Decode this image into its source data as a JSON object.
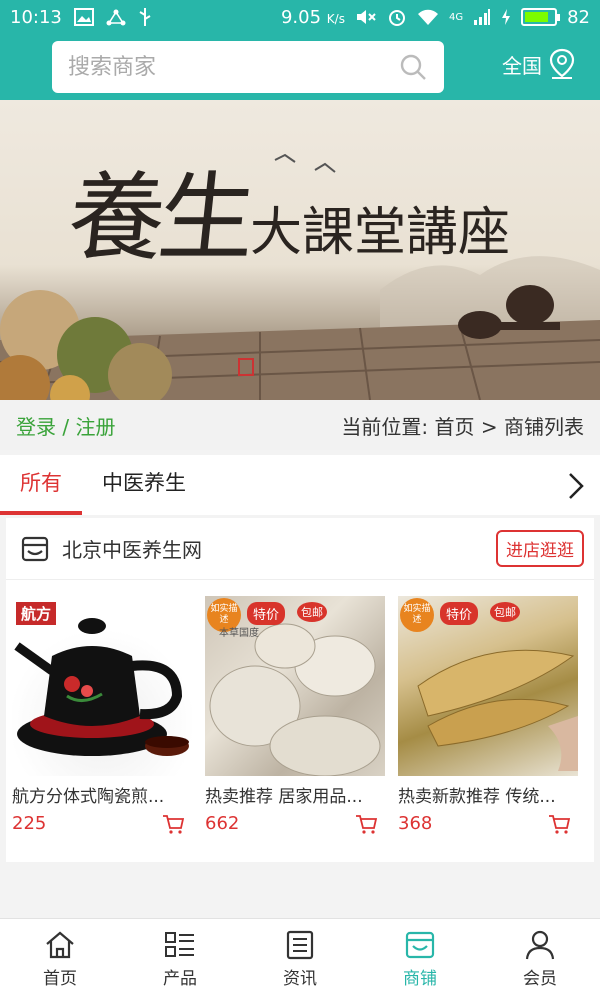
{
  "status_bar": {
    "time": "10:13",
    "speed": "9.05",
    "speed_unit": "K/s",
    "network": "4G",
    "battery": "82",
    "battery_level": 0.82
  },
  "search": {
    "placeholder": "搜索商家",
    "region_label": "全国"
  },
  "banner": {
    "title_big": "養生",
    "title_small": "大課堂講座"
  },
  "account": {
    "login_label": "登录 / 注册",
    "breadcrumb": "当前位置: 首页 > 商铺列表"
  },
  "tabs": [
    {
      "label": "所有",
      "active": true
    },
    {
      "label": "中医养生",
      "active": false
    }
  ],
  "shop": {
    "name": "北京中医养生网",
    "visit_label": "进店逛逛"
  },
  "products": [
    {
      "title": "航方分体式陶瓷煎...",
      "price": "225",
      "brand": "航方"
    },
    {
      "title": "热卖推荐 居家用品...",
      "price": "662",
      "badge_round": "如实描述",
      "badge_tag": "特价",
      "badge_mail": "包邮",
      "watermark": "本草国度"
    },
    {
      "title": "热卖新款推荐 传统...",
      "price": "368",
      "badge_round": "如实描述",
      "badge_tag": "特价",
      "badge_mail": "包邮"
    }
  ],
  "bottom_nav": [
    {
      "label": "首页",
      "icon": "home-icon"
    },
    {
      "label": "产品",
      "icon": "grid-list-icon"
    },
    {
      "label": "资讯",
      "icon": "news-icon"
    },
    {
      "label": "商铺",
      "icon": "shop-icon",
      "active": true
    },
    {
      "label": "会员",
      "icon": "user-icon"
    }
  ],
  "colors": {
    "brand": "#28b6a9",
    "accent": "#dd3333",
    "login": "#3aa33a"
  }
}
